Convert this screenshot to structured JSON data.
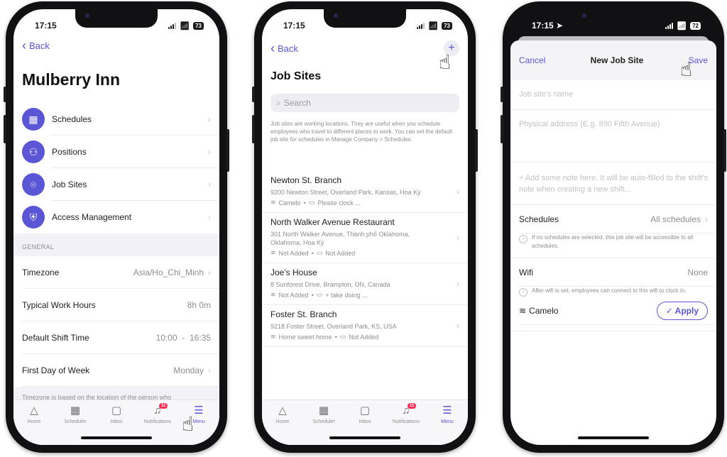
{
  "phone1": {
    "status": {
      "time": "17:15",
      "battery": "73"
    },
    "nav": {
      "back_label": "Back"
    },
    "title": "Mulberry Inn",
    "menu_items": [
      {
        "label": "Schedules",
        "icon": "calendar-icon"
      },
      {
        "label": "Positions",
        "icon": "people-icon"
      },
      {
        "label": "Job Sites",
        "icon": "location-pin-icon"
      },
      {
        "label": "Access Management",
        "icon": "shield-lock-icon"
      }
    ],
    "general_header": "GENERAL",
    "settings": [
      {
        "label": "Timezone",
        "value": "Asia/Ho_Chi_Minh"
      },
      {
        "label": "Typical Work Hours",
        "value": "8h 0m"
      },
      {
        "label": "Default Shift Time",
        "value": "10:00  -  16:35"
      },
      {
        "label": "First Day of Week",
        "value": "Monday"
      }
    ],
    "footer_note": "Timezone is based on the location of the person who",
    "active_tab": "Menu"
  },
  "phone2": {
    "status": {
      "time": "17:15",
      "battery": "73"
    },
    "nav": {
      "back_label": "Back",
      "add_label": "+"
    },
    "title": "Job Sites",
    "search": {
      "placeholder": "Search"
    },
    "description": "Job sites are working locations. They are useful when you schedule employees who travel to different places to work. You can set the default job site for schedules in Manage Company > Schedules.",
    "sites": [
      {
        "name": "Newton St. Branch",
        "address": "9200 Newton Street, Overland Park, Kansas, Hoa Kỳ",
        "wifi": "Camelo",
        "note": "Please clock ..."
      },
      {
        "name": "North Walker Avenue Restaurant",
        "address": "301 North Walker Avenue, Thành phố Oklahoma, Oklahoma, Hoa Kỳ",
        "wifi": "Not Added",
        "note": "Not Added"
      },
      {
        "name": "Joe's House",
        "address": "8 Sunforest Drive, Brampton, ON, Canada",
        "wifi": "Not Added",
        "note": "+ take doing ..."
      },
      {
        "name": "Foster St. Branch",
        "address": "9218 Foster Street, Overland Park, KS, USA",
        "wifi": "Home sweet home",
        "note": "Not Added"
      }
    ],
    "active_tab": "Menu"
  },
  "phone3": {
    "status": {
      "time": "17:15",
      "battery": "72"
    },
    "sheet": {
      "cancel_label": "Cancel",
      "title": "New Job Site",
      "save_label": "Save",
      "name_placeholder": "Job site's name",
      "address_placeholder": "Physical address (E.g. 890 Fifth Avenue)",
      "note_placeholder": "+ Add some note here. It will be auto-filled to the shift's note when creating a new shift...",
      "schedules_label": "Schedules",
      "schedules_value": "All schedules",
      "schedules_info": "If no schedules are selected, this job site will be accessible to all schedules.",
      "wifi_label": "Wifi",
      "wifi_value": "None",
      "wifi_info": "After wifi is set, employees can connect to this wifi to clock in.",
      "detected_wifi": "Camelo",
      "apply_label": "Apply"
    }
  },
  "tabs": [
    {
      "label": "Home",
      "icon": "home-icon"
    },
    {
      "label": "Scheduler",
      "icon": "scheduler-icon"
    },
    {
      "label": "Inbox",
      "icon": "inbox-icon"
    },
    {
      "label": "Notifications",
      "icon": "bell-icon",
      "badge": "11"
    },
    {
      "label": "Menu",
      "icon": "menu-icon"
    }
  ],
  "colors": {
    "accent": "#5b56d6",
    "badge": "#ff2d55",
    "secondary_text": "#8e8e93"
  }
}
